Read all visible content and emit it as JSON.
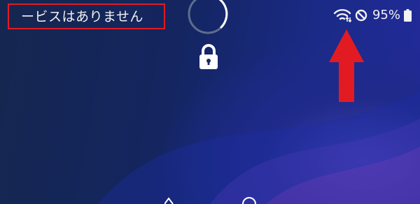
{
  "status_bar": {
    "carrier_text": "ービスはありません",
    "battery_percent": "95%",
    "wifi_icon": "wifi-icon",
    "do_not_disturb_icon": "no-entry-icon",
    "battery_icon": "battery-icon"
  },
  "lock_screen": {
    "fingerprint_ring_icon": "fingerprint-ring-icon",
    "lock_icon": "lock-icon"
  },
  "annotations": {
    "highlight_color": "#e21b23",
    "arrow_color": "#e21b23"
  }
}
